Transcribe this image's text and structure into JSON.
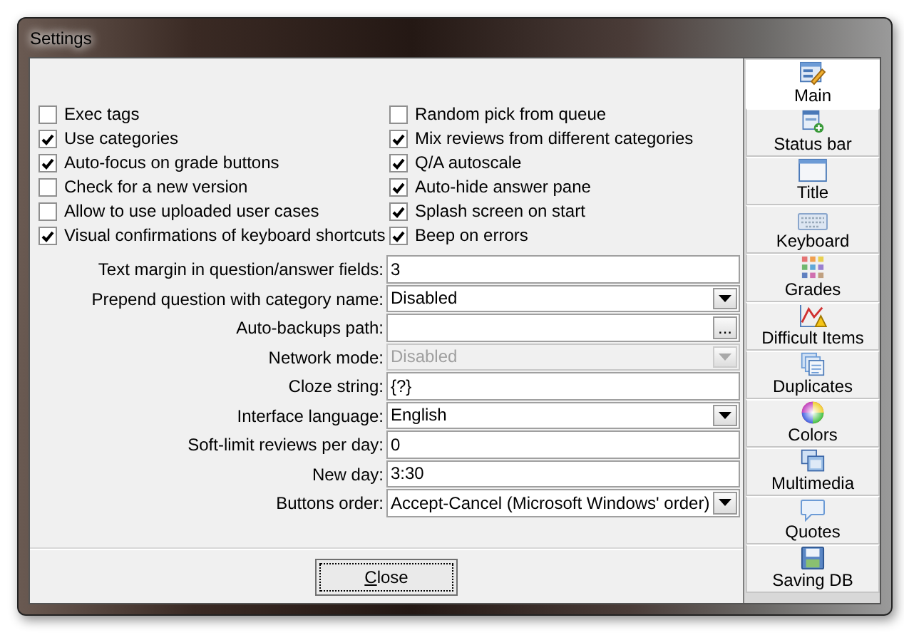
{
  "window": {
    "title": "Settings"
  },
  "options": [
    {
      "label": "Exec tags",
      "checked": false
    },
    {
      "label": "Random pick from queue",
      "checked": false
    },
    {
      "label": "Use categories",
      "checked": true
    },
    {
      "label": "Mix reviews from different categories",
      "checked": true
    },
    {
      "label": "Auto-focus on grade buttons",
      "checked": true
    },
    {
      "label": "Q/A autoscale",
      "checked": true
    },
    {
      "label": "Check for a new version",
      "checked": false
    },
    {
      "label": "Auto-hide answer pane",
      "checked": true
    },
    {
      "label": "Allow to use uploaded user cases",
      "checked": false
    },
    {
      "label": "Splash screen on start",
      "checked": true
    },
    {
      "label": "Visual confirmations of keyboard shortcuts",
      "checked": true
    },
    {
      "label": "Beep on errors",
      "checked": true
    }
  ],
  "fields": [
    {
      "kind": "text",
      "label": "Text margin in question/answer fields:",
      "value": "3",
      "disabled": false
    },
    {
      "kind": "dropdown",
      "label": "Prepend question with category name:",
      "value": "Disabled",
      "disabled": false
    },
    {
      "kind": "path",
      "label": "Auto-backups path:",
      "browse": "...",
      "disabled": false
    },
    {
      "kind": "dropdown",
      "label": "Network mode:",
      "value": "Disabled",
      "disabled": true
    },
    {
      "kind": "text",
      "label": "Cloze string:",
      "value": "{?}",
      "disabled": false
    },
    {
      "kind": "dropdown",
      "label": "Interface language:",
      "value": "English",
      "disabled": false
    },
    {
      "kind": "text",
      "label": "Soft-limit reviews per day:",
      "value": "0",
      "disabled": false
    },
    {
      "kind": "text",
      "label": "New day:",
      "value": "3:30",
      "disabled": false
    },
    {
      "kind": "dropdown",
      "label": "Buttons order:",
      "value": "Accept-Cancel (Microsoft Windows' order)",
      "disabled": false
    }
  ],
  "buttons": [
    "Close"
  ],
  "sidebar": {
    "items": [
      {
        "label": "Main",
        "selected": true
      },
      {
        "label": "Status bar",
        "selected": false
      },
      {
        "label": "Title",
        "selected": false
      },
      {
        "label": "Keyboard",
        "selected": false
      },
      {
        "label": "Grades",
        "selected": false
      },
      {
        "label": "Difficult Items",
        "selected": false
      },
      {
        "label": "Duplicates",
        "selected": false
      },
      {
        "label": "Colors",
        "selected": false
      },
      {
        "label": "Multimedia",
        "selected": false
      },
      {
        "label": "Quotes",
        "selected": false
      },
      {
        "label": "Saving DB",
        "selected": false
      }
    ]
  }
}
